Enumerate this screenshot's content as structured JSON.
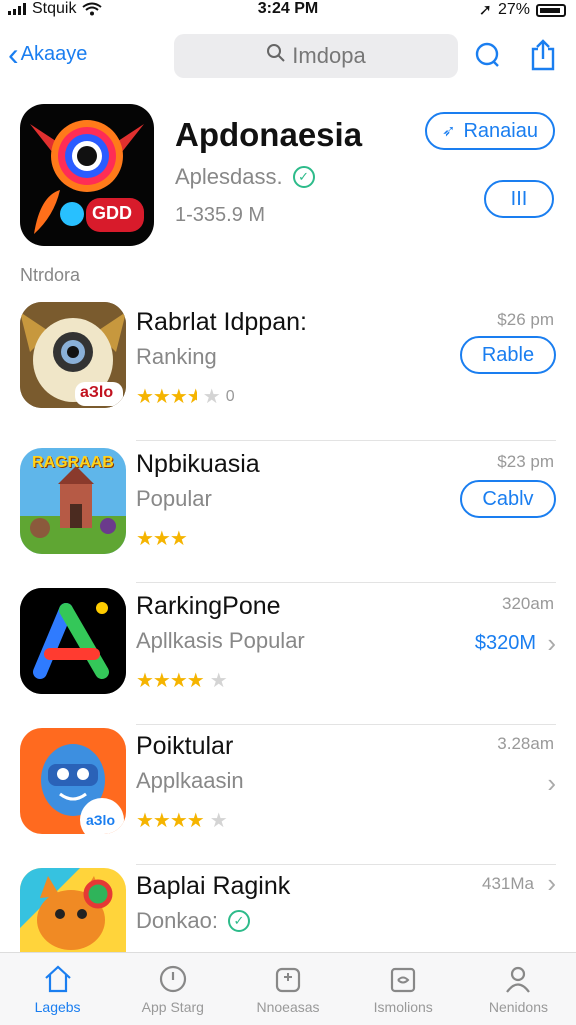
{
  "status_bar": {
    "carrier": "Stquik",
    "time": "3:24 PM",
    "battery": "27%"
  },
  "nav": {
    "back_label": "Akaaye",
    "search_placeholder": "Imdopa"
  },
  "featured": {
    "title": "Apdonaesia",
    "subtitle": "Aplesdass.",
    "size": "1-335.9 M",
    "primary_button": "Ranaiau",
    "secondary_button": "III",
    "icon_badge": "GDD"
  },
  "section_label": "Ntrdora",
  "apps": [
    {
      "title": "Rabrlat Idppan:",
      "subtitle": "Ranking",
      "meta": "$26 pm",
      "button": "Rable",
      "rating": 3.5,
      "rating_count": "0",
      "icon_label": "aЗlo",
      "icon": "owl-robot-app-icon"
    },
    {
      "title": "Npbikuasia",
      "subtitle": "Popular",
      "meta": "$23 pm",
      "button": "Cablv",
      "rating": 3,
      "icon_label": "RAGRAAB",
      "icon": "castle-game-app-icon"
    },
    {
      "title": "RarkingPone",
      "subtitle": "Apllkasis Popular",
      "meta": "320am",
      "price": "$320M",
      "rating": 4,
      "icon": "letter-a-app-icon"
    },
    {
      "title": "Poiktular",
      "subtitle": "Applkaasin",
      "meta": "3.28am",
      "rating": 4,
      "icon_label": "aЗlo",
      "icon": "cartoon-hero-app-icon"
    },
    {
      "title": "Baplai Ragink",
      "subtitle": "Donkao:",
      "meta": "431Ma",
      "rating": 0,
      "icon": "cartoon-cat-app-icon"
    }
  ],
  "tabs": [
    {
      "label": "Lagebs",
      "icon": "home-icon",
      "active": true
    },
    {
      "label": "App Starg",
      "icon": "clock-icon",
      "active": false
    },
    {
      "label": "Nnoeasas",
      "icon": "gamepad-icon",
      "active": false
    },
    {
      "label": "Ismolions",
      "icon": "apps-icon",
      "active": false
    },
    {
      "label": "Nenidons",
      "icon": "person-icon",
      "active": false
    }
  ],
  "colors": {
    "accent": "#1a7ef0",
    "star": "#f5b400",
    "verified": "#2dbb8a"
  }
}
